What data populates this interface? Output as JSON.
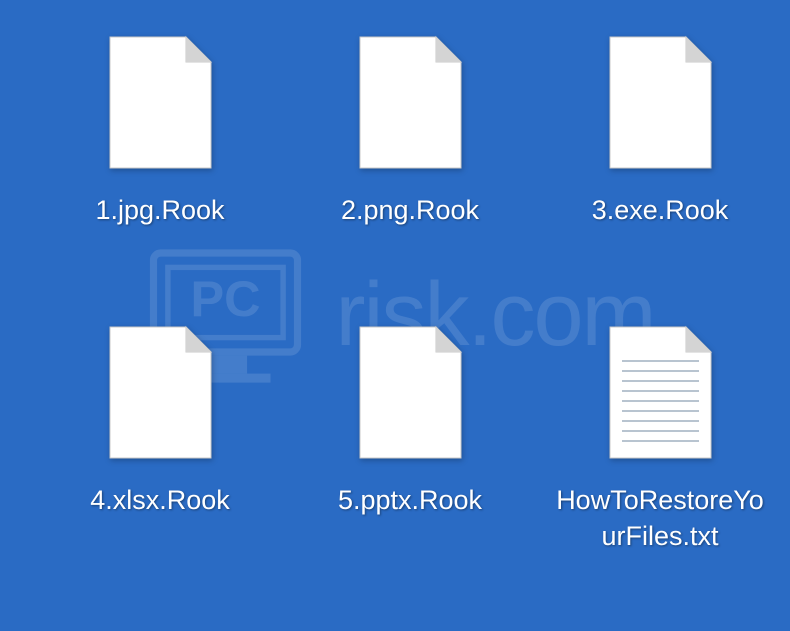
{
  "watermark": {
    "text": "risk.com"
  },
  "files": [
    {
      "name": "1.jpg.Rook",
      "type": "blank"
    },
    {
      "name": "2.png.Rook",
      "type": "blank"
    },
    {
      "name": "3.exe.Rook",
      "type": "blank"
    },
    {
      "name": "4.xlsx.Rook",
      "type": "blank"
    },
    {
      "name": "5.pptx.Rook",
      "type": "blank"
    },
    {
      "name": "HowToRestoreYourFiles.txt",
      "type": "text"
    }
  ]
}
